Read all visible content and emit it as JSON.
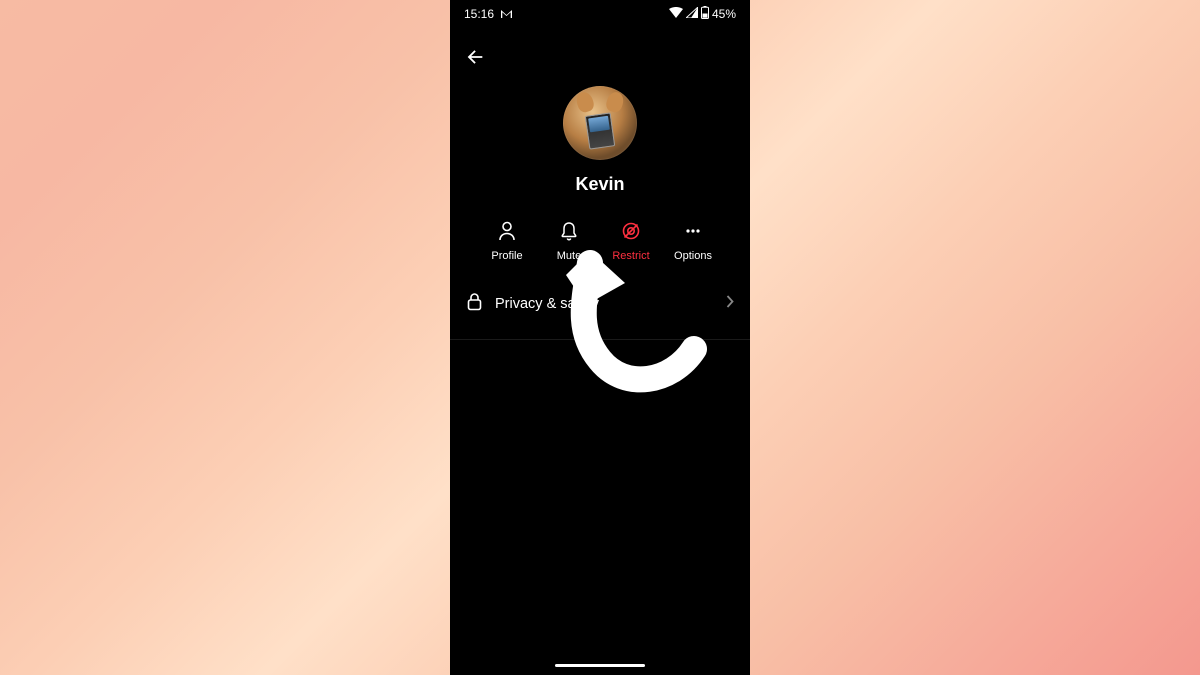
{
  "statusbar": {
    "time": "15:16",
    "app_icon": "M",
    "battery_text": "45%"
  },
  "profile": {
    "username": "Kevin"
  },
  "actions": {
    "profile": "Profile",
    "mute": "Mute",
    "restrict": "Restrict",
    "options": "Options"
  },
  "settings": {
    "privacy_label": "Privacy & safety"
  }
}
